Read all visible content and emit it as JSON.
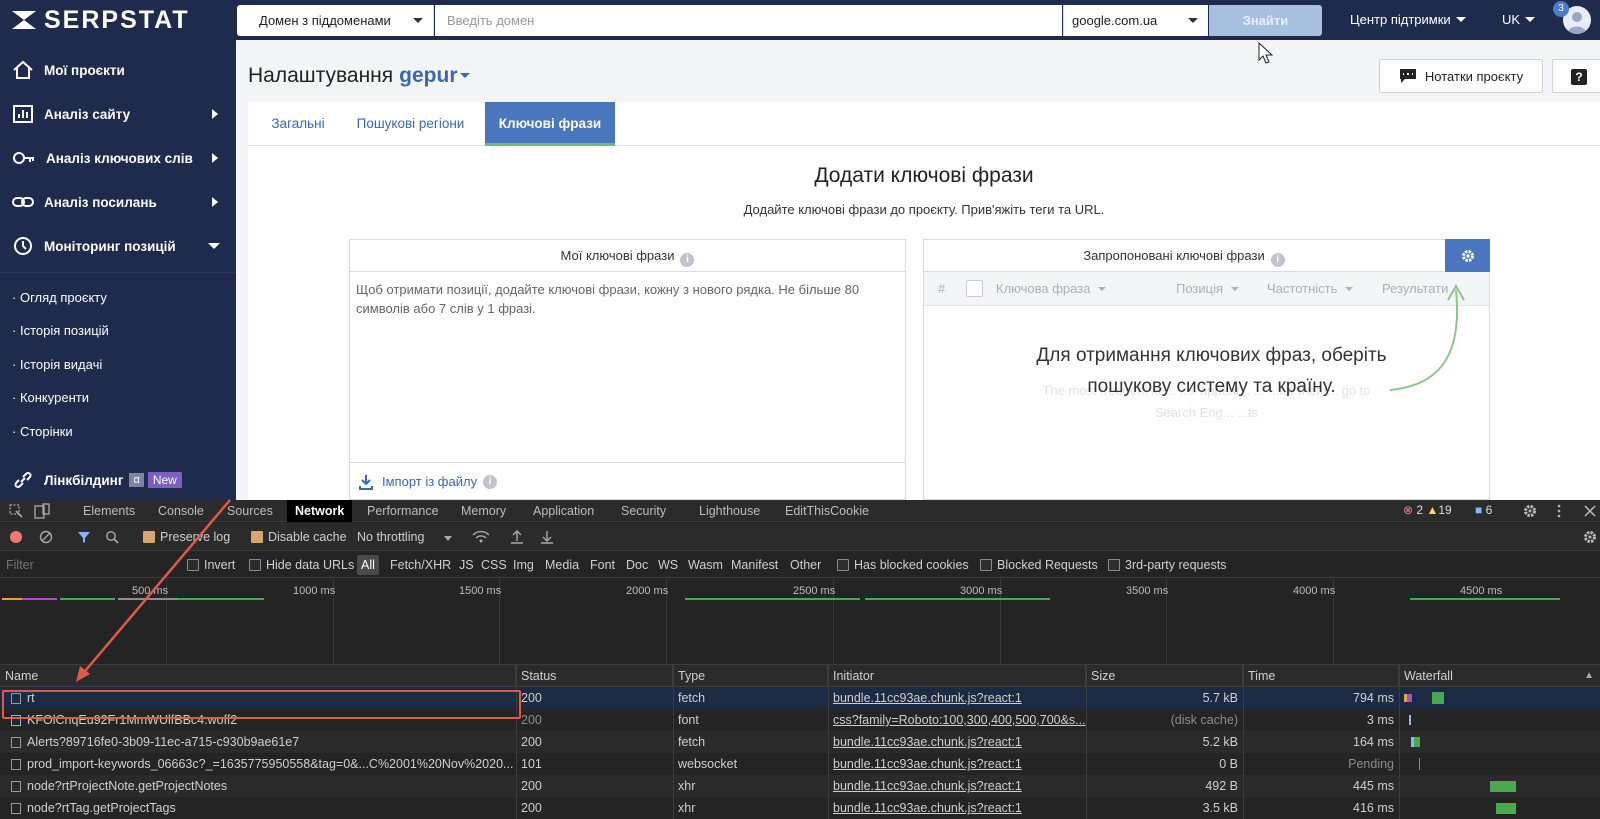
{
  "header": {
    "logo": "SERPSTAT",
    "scope_select": "Домен з піддоменами",
    "search_placeholder": "Введіть домен",
    "engine_select": "google.com.ua",
    "find_button": "Знайти",
    "support": "Центр підтримки",
    "language": "UK",
    "notification_count": "3"
  },
  "sidebar": {
    "items": [
      {
        "label": "Мої проєкти",
        "icon": "home-icon"
      },
      {
        "label": "Аналіз сайту",
        "icon": "chart-icon"
      },
      {
        "label": "Аналіз ключових слів",
        "icon": "key-icon"
      },
      {
        "label": "Аналіз посилань",
        "icon": "link-icon"
      },
      {
        "label": "Моніторинг позицій",
        "icon": "history-icon"
      }
    ],
    "subitems": [
      "Огляд проєкту",
      "Історія позицій",
      "Історія видачі",
      "Конкуренти",
      "Сторінки"
    ],
    "linkbuilding": {
      "label": "Лінкбілдинг",
      "alpha": "α",
      "new": "New"
    }
  },
  "page": {
    "title": "Налаштування",
    "project": "gepur",
    "notes_button": "Нотатки проєкту",
    "help_button": "?",
    "tabs": [
      "Загальні",
      "Пошукові регіони",
      "Ключові фрази"
    ],
    "add_title": "Додати ключові фрази",
    "add_subtitle": "Додайте ключові фрази до проєкту. Прив'яжіть теги та URL.",
    "my_keywords": {
      "title": "Мої ключові фрази",
      "placeholder": "Щоб отримати позиції, додайте ключові фрази, кожну з нового рядка. Не більше 80 символів або 7 слів у 1 фразі.",
      "import": "Імпорт із файлу"
    },
    "suggested": {
      "title": "Запропоновані ключові фрази",
      "columns": [
        "#",
        "Ключова фраза",
        "Позиція",
        "Частотність",
        "Результати"
      ],
      "faded_line1": "The most frequent ke... ...ll appear... ... ...for them... go to",
      "faded_line2": "Search Eng... ...ts",
      "message": "Для отримання ключових фраз, оберіть пошукову систему та країну."
    }
  },
  "devtools": {
    "tabs": [
      "Elements",
      "Console",
      "Sources",
      "Network",
      "Performance",
      "Memory",
      "Application",
      "Security",
      "Lighthouse",
      "EditThisCookie"
    ],
    "errors": "2",
    "warnings": "19",
    "messages": "6",
    "toolbar": {
      "preserve_log": "Preserve log",
      "disable_cache": "Disable cache",
      "throttling": "No throttling"
    },
    "filter": {
      "placeholder": "Filter",
      "invert": "Invert",
      "hide_data_urls": "Hide data URLs",
      "types": [
        "All",
        "Fetch/XHR",
        "JS",
        "CSS",
        "Img",
        "Media",
        "Font",
        "Doc",
        "WS",
        "Wasm",
        "Manifest",
        "Other"
      ],
      "has_blocked_cookies": "Has blocked cookies",
      "blocked_requests": "Blocked Requests",
      "third_party": "3rd-party requests"
    },
    "timeline_labels": [
      "500 ms",
      "1000 ms",
      "1500 ms",
      "2000 ms",
      "2500 ms",
      "3000 ms",
      "3500 ms",
      "4000 ms",
      "4500 ms"
    ],
    "columns": [
      "Name",
      "Status",
      "Type",
      "Initiator",
      "Size",
      "Time",
      "Waterfall"
    ],
    "rows": [
      {
        "name": "rt",
        "status": "200",
        "type": "fetch",
        "initiator": "bundle.11cc93ae.chunk.js?react:1",
        "size": "5.7 kB",
        "time": "794 ms"
      },
      {
        "name": "KFOlCnqEu92Fr1MmWUlfBBc4.woff2",
        "status": "200",
        "type": "font",
        "initiator": "css?family=Roboto:100,300,400,500,700&s...",
        "size": "(disk cache)",
        "time": "3 ms"
      },
      {
        "name": "Alerts?89716fe0-3b09-11ec-a715-c930b9ae61e7",
        "status": "200",
        "type": "fetch",
        "initiator": "bundle.11cc93ae.chunk.js?react:1",
        "size": "5.2 kB",
        "time": "164 ms"
      },
      {
        "name": "prod_import-keywords_06663c?_=1635775950558&tag=0&...C%2001%20Nov%2020...",
        "status": "101",
        "type": "websocket",
        "initiator": "bundle.11cc93ae.chunk.js?react:1",
        "size": "0 B",
        "time": "Pending"
      },
      {
        "name": "node?rtProjectNote.getProjectNotes",
        "status": "200",
        "type": "xhr",
        "initiator": "bundle.11cc93ae.chunk.js?react:1",
        "size": "492 B",
        "time": "445 ms"
      },
      {
        "name": "node?rtTag.getProjectTags",
        "status": "200",
        "type": "xhr",
        "initiator": "bundle.11cc93ae.chunk.js?react:1",
        "size": "3.5 kB",
        "time": "416 ms"
      }
    ]
  }
}
